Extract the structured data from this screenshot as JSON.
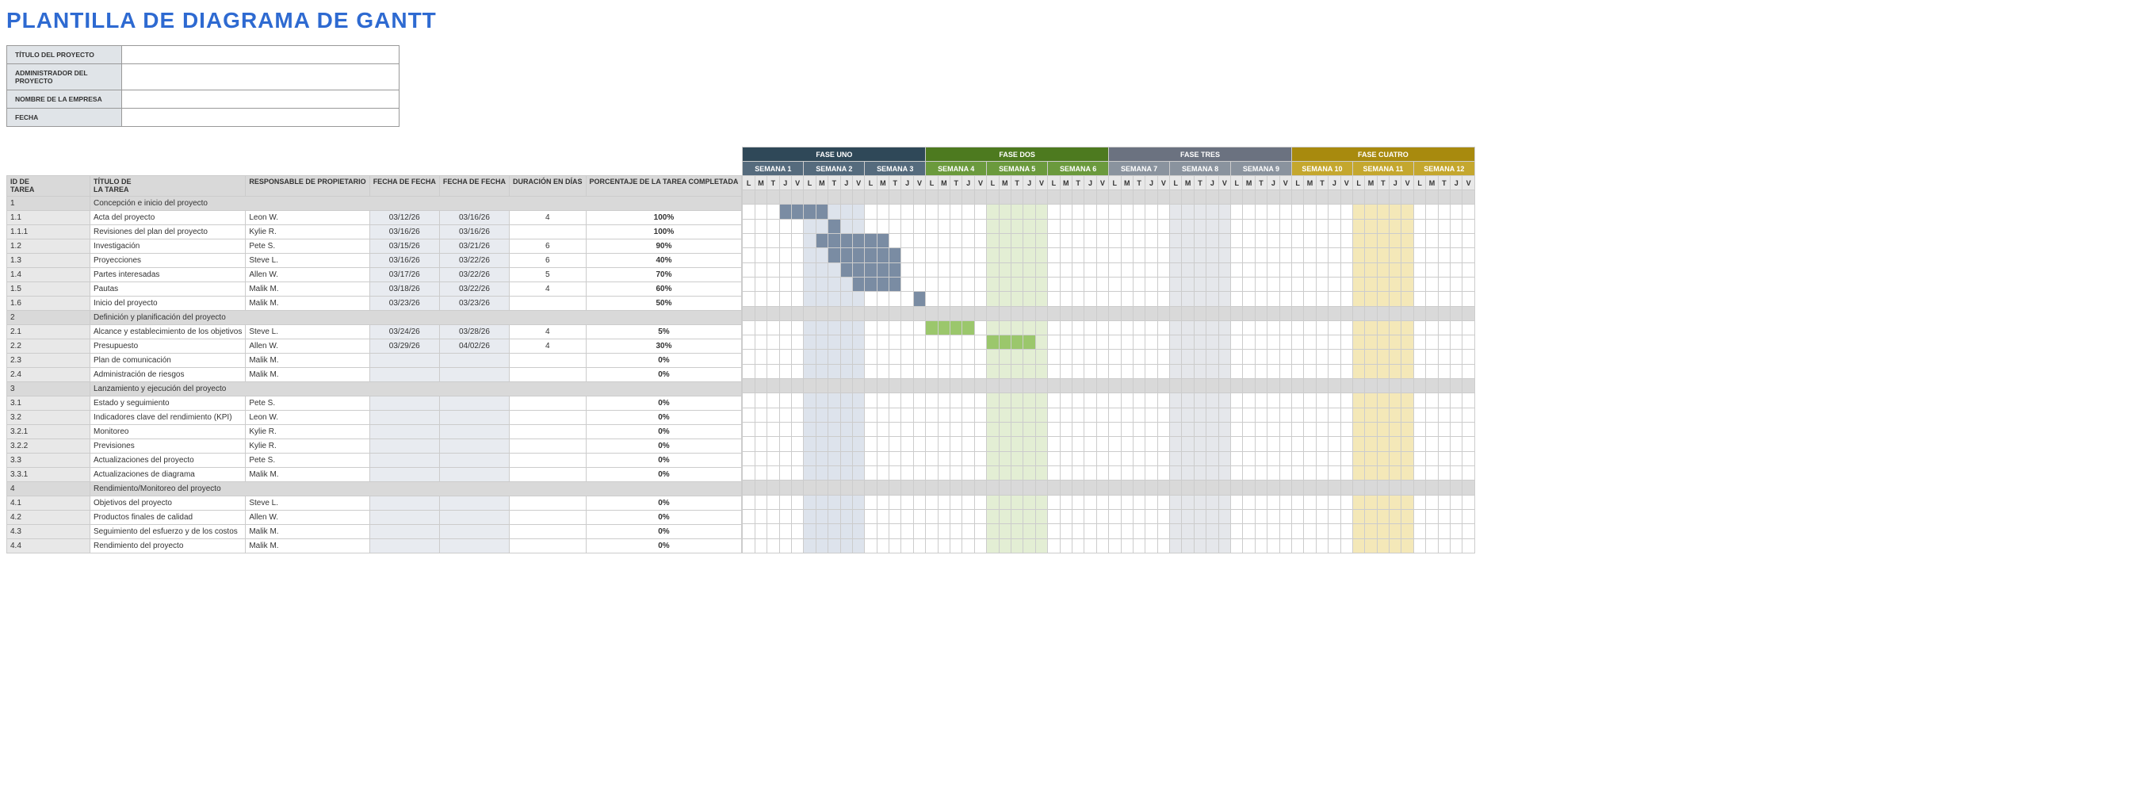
{
  "title": "PLANTILLA DE DIAGRAMA DE GANTT",
  "header_fields": [
    {
      "label": "TÍTULO DEL PROYECTO",
      "value": ""
    },
    {
      "label": "ADMINISTRADOR DEL PROYECTO",
      "value": ""
    },
    {
      "label": "NOMBRE DE LA EMPRESA",
      "value": ""
    },
    {
      "label": "FECHA",
      "value": ""
    }
  ],
  "columns": {
    "id": "ID DE\nTAREA",
    "title": "TÍTULO DE\nLA TAREA",
    "owner": "RESPONSABLE DE PROPIETARIO",
    "start": "FECHA DE FECHA",
    "end": "FECHA DE FECHA",
    "dur": "DURACIÓN EN DÍAS",
    "pct": "PORCENTAJE DE LA TAREA COMPLETADA"
  },
  "phases": [
    {
      "label": "FASE UNO",
      "class": "phase-1",
      "week_class": "week-p1",
      "shade": "shade-p1",
      "weeks": [
        "SEMANA 1",
        "SEMANA 2",
        "SEMANA 3"
      ]
    },
    {
      "label": "FASE DOS",
      "class": "phase-2",
      "week_class": "week-p2",
      "shade": "shade-p2",
      "weeks": [
        "SEMANA 4",
        "SEMANA 5",
        "SEMANA 6"
      ]
    },
    {
      "label": "FASE TRES",
      "class": "phase-3",
      "week_class": "week-p3",
      "shade": "shade-p3",
      "weeks": [
        "SEMANA 7",
        "SEMANA 8",
        "SEMANA 9"
      ]
    },
    {
      "label": "FASE CUATRO",
      "class": "phase-4",
      "week_class": "week-p4",
      "shade": "shade-p4",
      "weeks": [
        "SEMANA 10",
        "SEMANA 11",
        "SEMANA 12"
      ]
    }
  ],
  "days": [
    "L",
    "M",
    "T",
    "J",
    "V"
  ],
  "shaded_weeks": [
    1,
    4,
    7,
    10
  ],
  "tasks": [
    {
      "id": "1",
      "title": "Concepción e inicio del proyecto",
      "section": true
    },
    {
      "id": "1.1",
      "title": "Acta del proyecto",
      "owner": "Leon W.",
      "start": "03/12/26",
      "end": "03/16/26",
      "dur": "4",
      "pct": "100%",
      "bar_start": 3,
      "bar_len": 4,
      "bar_class": "bar-p1"
    },
    {
      "id": "1.1.1",
      "title": "Revisiones del plan del proyecto",
      "owner": "Kylie R.",
      "start": "03/16/26",
      "end": "03/16/26",
      "dur": "",
      "pct": "100%",
      "bar_start": 7,
      "bar_len": 1,
      "bar_class": "bar-p1"
    },
    {
      "id": "1.2",
      "title": "Investigación",
      "owner": "Pete S.",
      "start": "03/15/26",
      "end": "03/21/26",
      "dur": "6",
      "pct": "90%",
      "bar_start": 6,
      "bar_len": 6,
      "bar_class": "bar-p1"
    },
    {
      "id": "1.3",
      "title": "Proyecciones",
      "owner": "Steve L.",
      "start": "03/16/26",
      "end": "03/22/26",
      "dur": "6",
      "pct": "40%",
      "bar_start": 7,
      "bar_len": 6,
      "bar_class": "bar-p1"
    },
    {
      "id": "1.4",
      "title": "Partes interesadas",
      "owner": "Allen W.",
      "start": "03/17/26",
      "end": "03/22/26",
      "dur": "5",
      "pct": "70%",
      "bar_start": 8,
      "bar_len": 5,
      "bar_class": "bar-p1"
    },
    {
      "id": "1.5",
      "title": "Pautas",
      "owner": "Malik M.",
      "start": "03/18/26",
      "end": "03/22/26",
      "dur": "4",
      "pct": "60%",
      "bar_start": 9,
      "bar_len": 4,
      "bar_class": "bar-p1"
    },
    {
      "id": "1.6",
      "title": "Inicio del proyecto",
      "owner": "Malik M.",
      "start": "03/23/26",
      "end": "03/23/26",
      "dur": "",
      "pct": "50%",
      "bar_start": 14,
      "bar_len": 1,
      "bar_class": "bar-p1"
    },
    {
      "id": "2",
      "title": "Definición y planificación del proyecto",
      "section": true
    },
    {
      "id": "2.1",
      "title": "Alcance y establecimiento de los objetivos",
      "owner": "Steve L.",
      "start": "03/24/26",
      "end": "03/28/26",
      "dur": "4",
      "pct": "5%",
      "bar_start": 15,
      "bar_len": 4,
      "bar_class": "bar-p2"
    },
    {
      "id": "2.2",
      "title": "Presupuesto",
      "owner": "Allen W.",
      "start": "03/29/26",
      "end": "04/02/26",
      "dur": "4",
      "pct": "30%",
      "bar_start": 20,
      "bar_len": 4,
      "bar_class": "bar-p2"
    },
    {
      "id": "2.3",
      "title": "Plan de comunicación",
      "owner": "Malik M.",
      "start": "",
      "end": "",
      "dur": "",
      "pct": "0%"
    },
    {
      "id": "2.4",
      "title": "Administración de riesgos",
      "owner": "Malik M.",
      "start": "",
      "end": "",
      "dur": "",
      "pct": "0%"
    },
    {
      "id": "3",
      "title": "Lanzamiento y ejecución del proyecto",
      "section": true
    },
    {
      "id": "3.1",
      "title": "Estado y seguimiento",
      "owner": "Pete S.",
      "start": "",
      "end": "",
      "dur": "",
      "pct": "0%"
    },
    {
      "id": "3.2",
      "title": "Indicadores clave del rendimiento (KPI)",
      "owner": "Leon W.",
      "start": "",
      "end": "",
      "dur": "",
      "pct": "0%"
    },
    {
      "id": "3.2.1",
      "title": "Monitoreo",
      "owner": "Kylie R.",
      "start": "",
      "end": "",
      "dur": "",
      "pct": "0%"
    },
    {
      "id": "3.2.2",
      "title": "Previsiones",
      "owner": "Kylie R.",
      "start": "",
      "end": "",
      "dur": "",
      "pct": "0%"
    },
    {
      "id": "3.3",
      "title": "Actualizaciones del proyecto",
      "owner": "Pete S.",
      "start": "",
      "end": "",
      "dur": "",
      "pct": "0%"
    },
    {
      "id": "3.3.1",
      "title": "Actualizaciones de diagrama",
      "owner": "Malik M.",
      "start": "",
      "end": "",
      "dur": "",
      "pct": "0%"
    },
    {
      "id": "4",
      "title": "Rendimiento/Monitoreo del proyecto",
      "section": true
    },
    {
      "id": "4.1",
      "title": "Objetivos del proyecto",
      "owner": "Steve L.",
      "start": "",
      "end": "",
      "dur": "",
      "pct": "0%"
    },
    {
      "id": "4.2",
      "title": "Productos finales de calidad",
      "owner": "Allen W.",
      "start": "",
      "end": "",
      "dur": "",
      "pct": "0%"
    },
    {
      "id": "4.3",
      "title": "Seguimiento del esfuerzo y de los costos",
      "owner": "Malik M.",
      "start": "",
      "end": "",
      "dur": "",
      "pct": "0%"
    },
    {
      "id": "4.4",
      "title": "Rendimiento del proyecto",
      "owner": "Malik M.",
      "start": "",
      "end": "",
      "dur": "",
      "pct": "0%"
    }
  ]
}
